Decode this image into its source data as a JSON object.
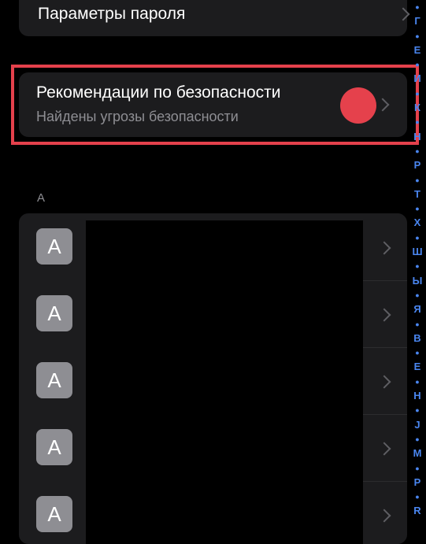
{
  "password_options": {
    "label": "Параметры пароля"
  },
  "security_recommendations": {
    "title": "Рекомендации по безопасности",
    "subtitle": "Найдены угрозы безопасности"
  },
  "section_header": "А",
  "entries": [
    {
      "avatar_letter": "A"
    },
    {
      "avatar_letter": "A"
    },
    {
      "avatar_letter": "A"
    },
    {
      "avatar_letter": "A"
    },
    {
      "avatar_letter": "A"
    }
  ],
  "index_bar": [
    "●",
    "Г",
    "●",
    "Е",
    "●",
    "И",
    "●",
    "К",
    "●",
    "Н",
    "●",
    "Р",
    "●",
    "Т",
    "●",
    "Х",
    "●",
    "Ш",
    "●",
    "Ы",
    "●",
    "Я",
    "●",
    "В",
    "●",
    "Е",
    "●",
    "Н",
    "●",
    "J",
    "●",
    "M",
    "●",
    "P",
    "●",
    "R"
  ],
  "colors": {
    "accent_red": "#e5414c",
    "index_blue": "#4a86f0",
    "card_bg": "#1c1c1e"
  }
}
